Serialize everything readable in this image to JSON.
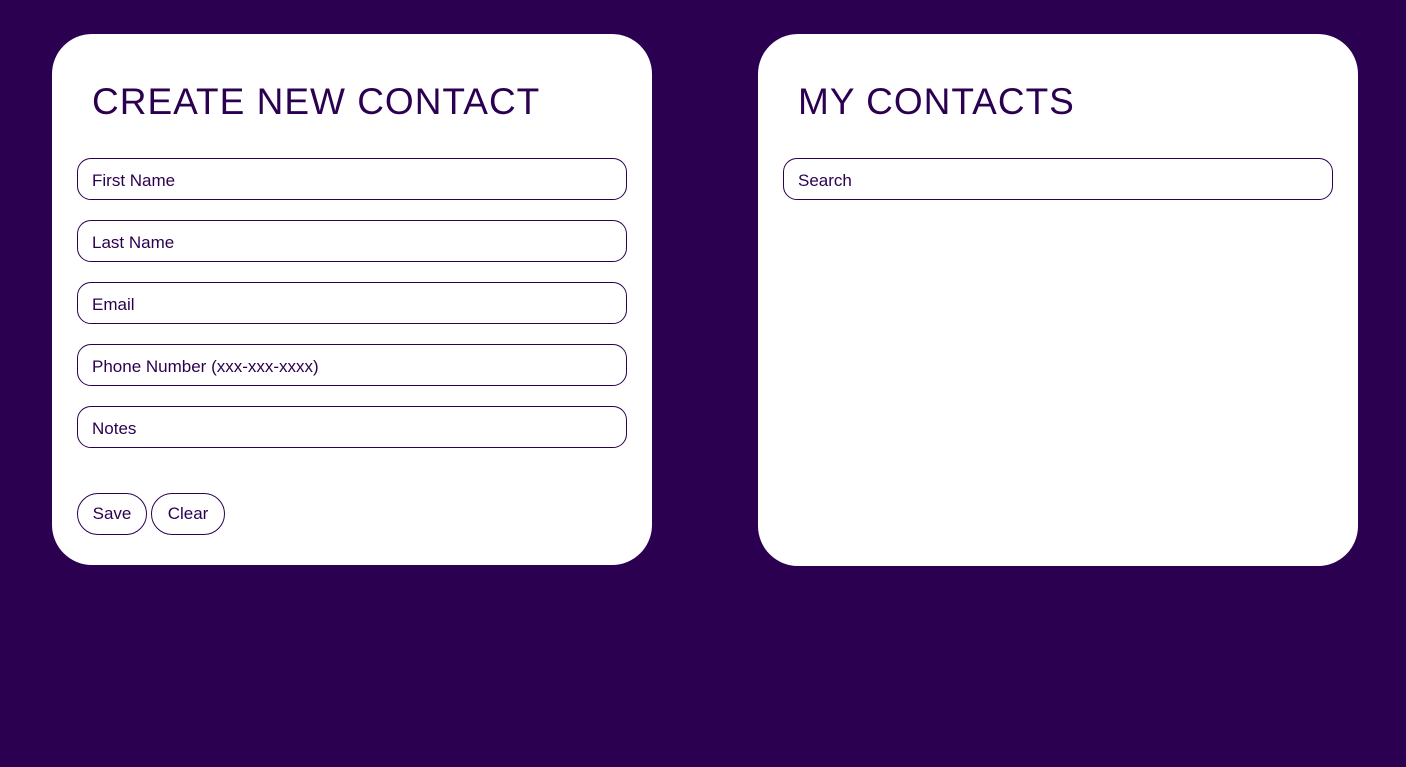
{
  "create_panel": {
    "title": "CREATE NEW CONTACT",
    "fields": {
      "first_name": {
        "placeholder": "First Name",
        "value": ""
      },
      "last_name": {
        "placeholder": "Last Name",
        "value": ""
      },
      "email": {
        "placeholder": "Email",
        "value": ""
      },
      "phone": {
        "placeholder": "Phone Number (xxx-xxx-xxxx)",
        "value": ""
      },
      "notes": {
        "placeholder": "Notes",
        "value": ""
      }
    },
    "buttons": {
      "save_label": "Save",
      "clear_label": "Clear"
    }
  },
  "contacts_panel": {
    "title": "MY CONTACTS",
    "search": {
      "placeholder": "Search",
      "value": ""
    },
    "contacts": []
  },
  "colors": {
    "background": "#2b0050",
    "panel": "#ffffff",
    "accent": "#2b0050"
  }
}
